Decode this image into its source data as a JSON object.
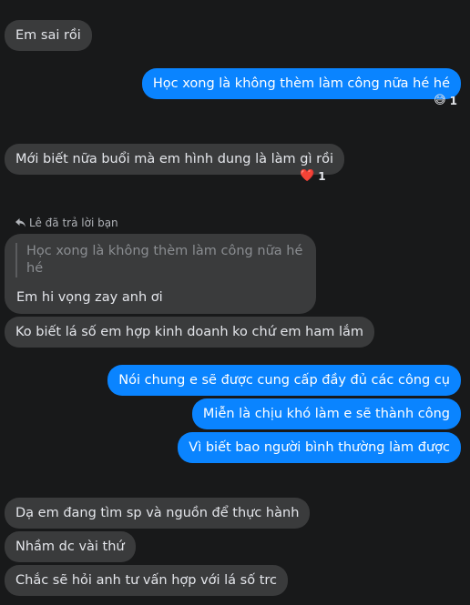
{
  "messages": {
    "m1": "Em sai rồi",
    "m2": "Học xong là không thèm làm công nữa hé hé",
    "m3": "Mới biết nữa buổi mà em hình dung là làm gì rồi",
    "m5": "Ko biết lá số em hợp kinh doanh ko chứ em ham lắm",
    "m6": "Nói chung e sẽ được cung cấp đầy đủ các công cụ",
    "m7": "Miễn là chịu khó làm e sẽ thành công",
    "m8": "Vì biết bao người bình thường làm được",
    "m9": "Dạ em đang tìm sp và nguồn để thực hành",
    "m10": "Nhầm dc vài thứ",
    "m11": "Chắc sẽ hỏi anh tư vấn hợp với lá số trc"
  },
  "reactions": {
    "r1": {
      "emoji": "😅",
      "count": "1",
      "icon": "grinning-sweat-emoji"
    },
    "r2": {
      "emoji": "❤️",
      "count": "1",
      "icon": "heart-emoji"
    }
  },
  "reply": {
    "label": "Lê đã trả lời bạn",
    "icon": "reply-arrow-icon",
    "quoted": "Học xong là không thèm làm công nữa hé hé",
    "text": "Em hi vọng zay anh ơi"
  },
  "colors": {
    "background": "#18191a",
    "incoming_bubble": "#3a3b3c",
    "outgoing_bubble": "#0a84ff"
  }
}
